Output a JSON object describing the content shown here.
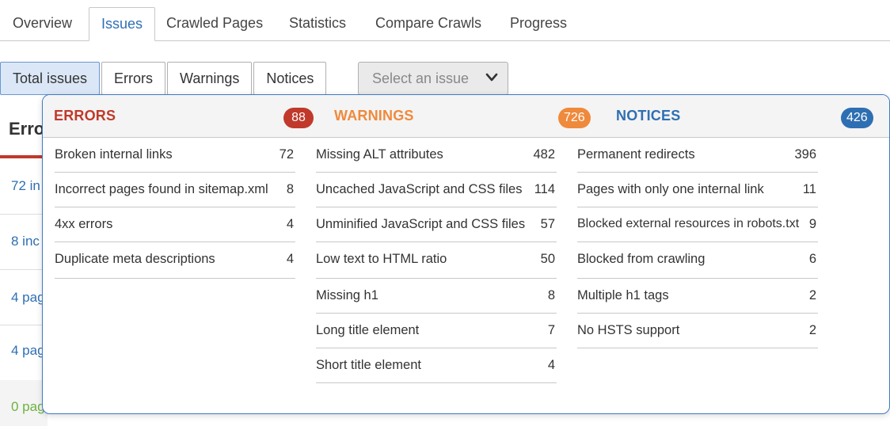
{
  "tabs": [
    {
      "label": "Overview",
      "active": false
    },
    {
      "label": "Issues",
      "active": true
    },
    {
      "label": "Crawled Pages",
      "active": false
    },
    {
      "label": "Statistics",
      "active": false
    },
    {
      "label": "Compare Crawls",
      "active": false
    },
    {
      "label": "Progress",
      "active": false
    }
  ],
  "filters": {
    "total": "Total issues",
    "errors": "Errors",
    "warnings": "Warnings",
    "notices": "Notices"
  },
  "select": {
    "placeholder": "Select an issue"
  },
  "background": {
    "heading": "Erro",
    "items": [
      "72 in",
      "8 inc",
      "4 pag",
      "4 pag",
      "0 pag"
    ]
  },
  "panel": {
    "errors": {
      "title": "ERRORS",
      "count": "88",
      "color": "#c0392b",
      "items": [
        {
          "label": "Broken internal links",
          "count": "72"
        },
        {
          "label": "Incorrect pages found in sitemap.xml",
          "count": "8"
        },
        {
          "label": "4xx errors",
          "count": "4"
        },
        {
          "label": "Duplicate meta descriptions",
          "count": "4"
        }
      ]
    },
    "warnings": {
      "title": "WARNINGS",
      "count": "726",
      "color": "#ef8a3c",
      "items": [
        {
          "label": "Missing ALT attributes",
          "count": "482"
        },
        {
          "label": "Uncached JavaScript and CSS files",
          "count": "114"
        },
        {
          "label": "Unminified JavaScript and CSS files",
          "count": "57"
        },
        {
          "label": "Low text to HTML ratio",
          "count": "50"
        },
        {
          "label": "Missing h1",
          "count": "8"
        },
        {
          "label": "Long title element",
          "count": "7"
        },
        {
          "label": "Short title element",
          "count": "4"
        }
      ]
    },
    "notices": {
      "title": "NOTICES",
      "count": "426",
      "color": "#2e6fb3",
      "items": [
        {
          "label": "Permanent redirects",
          "count": "396"
        },
        {
          "label": "Pages with only one internal link",
          "count": "11"
        },
        {
          "label": "Blocked external resources in robots.txt",
          "count": "9"
        },
        {
          "label": "Blocked from crawling",
          "count": "6"
        },
        {
          "label": "Multiple h1 tags",
          "count": "2"
        },
        {
          "label": "No HSTS support",
          "count": "2"
        }
      ]
    }
  }
}
